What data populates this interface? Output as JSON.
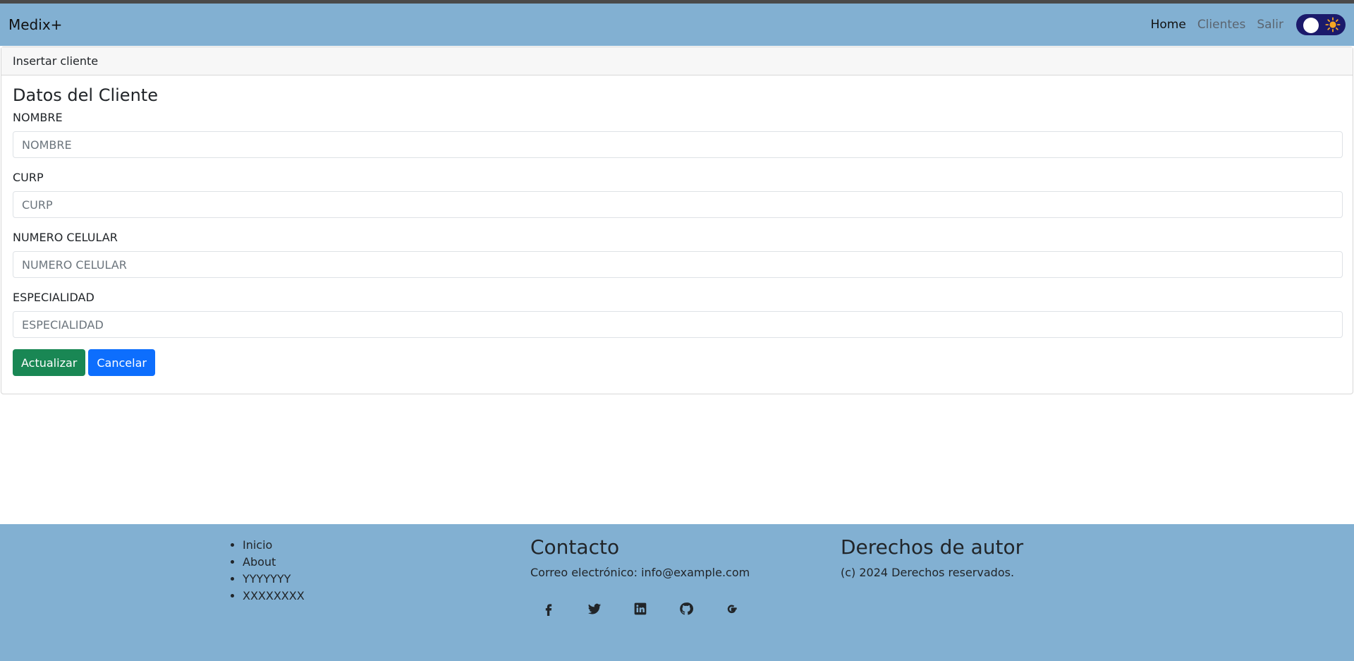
{
  "navbar": {
    "brand": "Medix+",
    "links": [
      {
        "label": "Home",
        "active": true
      },
      {
        "label": "Clientes",
        "active": false
      },
      {
        "label": "Salir",
        "active": false
      }
    ],
    "theme_toggle_icon": "sun-icon"
  },
  "card": {
    "header": "Insertar cliente",
    "title": "Datos del Cliente",
    "fields": [
      {
        "label": "NOMBRE",
        "placeholder": "NOMBRE",
        "value": ""
      },
      {
        "label": "CURP",
        "placeholder": "CURP",
        "value": ""
      },
      {
        "label": "NUMERO CELULAR",
        "placeholder": "NUMERO CELULAR",
        "value": ""
      },
      {
        "label": "ESPECIALIDAD",
        "placeholder": "ESPECIALIDAD",
        "value": ""
      }
    ],
    "buttons": {
      "update": "Actualizar",
      "cancel": "Cancelar"
    }
  },
  "footer": {
    "links": [
      "Inicio",
      "About",
      "YYYYYYY",
      "XXXXXXXX"
    ],
    "contact": {
      "title": "Contacto",
      "email": "Correo electrónico: info@example.com",
      "socials": [
        "facebook-icon",
        "twitter-icon",
        "linkedin-icon",
        "github-icon",
        "google-icon"
      ]
    },
    "rights": {
      "title": "Derechos de autor",
      "text": "(c) 2024 Derechos reservados."
    }
  },
  "colors": {
    "navbar_bg": "#82b0d2",
    "success": "#198754",
    "primary": "#0d6efd",
    "toggle_bg": "#1b1a6b",
    "sun": "#f5a623"
  }
}
